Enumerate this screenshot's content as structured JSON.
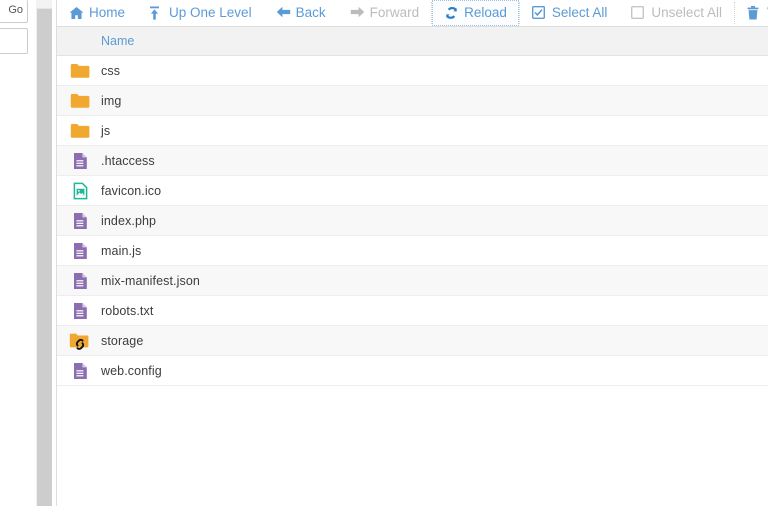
{
  "left_panel": {
    "go_button_label": "Go",
    "address_input_value": ""
  },
  "toolbar": {
    "buttons": [
      {
        "label": "Home",
        "icon": "home-icon",
        "state": "enabled"
      },
      {
        "label": "Up One Level",
        "icon": "up-level-icon",
        "state": "enabled"
      },
      {
        "label": "Back",
        "icon": "arrow-left-icon",
        "state": "enabled"
      },
      {
        "label": "Forward",
        "icon": "arrow-right-icon",
        "state": "disabled"
      },
      {
        "label": "Reload",
        "icon": "refresh-icon",
        "state": "focused"
      },
      {
        "label": "Select All",
        "icon": "checkbox-checked-icon",
        "state": "enabled"
      },
      {
        "label": "Unselect All",
        "icon": "checkbox-empty-icon",
        "state": "disabled"
      },
      {
        "label": "Vi",
        "icon": "trash-icon",
        "state": "enabled"
      }
    ]
  },
  "file_table": {
    "columns": [
      "Name"
    ],
    "rows": [
      {
        "name": "css",
        "icon": "folder-icon"
      },
      {
        "name": "img",
        "icon": "folder-icon"
      },
      {
        "name": "js",
        "icon": "folder-icon"
      },
      {
        "name": ".htaccess",
        "icon": "file-document-icon"
      },
      {
        "name": "favicon.ico",
        "icon": "file-image-icon"
      },
      {
        "name": "index.php",
        "icon": "file-document-icon"
      },
      {
        "name": "main.js",
        "icon": "file-document-icon"
      },
      {
        "name": "mix-manifest.json",
        "icon": "file-document-icon"
      },
      {
        "name": "robots.txt",
        "icon": "file-document-icon"
      },
      {
        "name": "storage",
        "icon": "folder-symlink-icon"
      },
      {
        "name": "web.config",
        "icon": "file-document-icon"
      }
    ]
  },
  "colors": {
    "accent_blue": "#5b9bd5",
    "disabled_gray": "#bcbcbc",
    "folder_amber": "#f0a830",
    "file_purple": "#8b6db0",
    "image_green": "#1fb894",
    "row_alt": "#f8f8f8",
    "header_band": "#f2f2f2"
  }
}
